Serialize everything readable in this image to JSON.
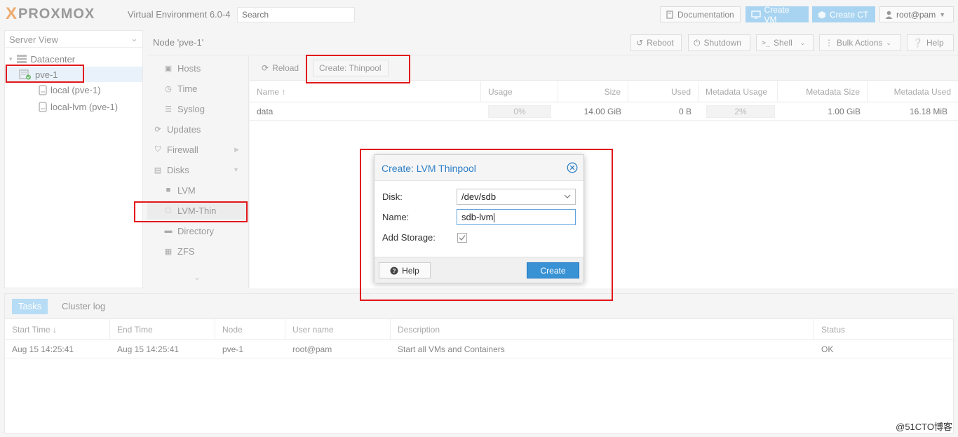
{
  "header": {
    "logo_x": "X",
    "logo_text": "PROXMOX",
    "version": "Virtual Environment 6.0-4",
    "search_placeholder": "Search",
    "documentation": "Documentation",
    "create_vm": "Create VM",
    "create_ct": "Create CT",
    "user": "root@pam"
  },
  "sidebar": {
    "view": "Server View",
    "items": [
      {
        "label": "Datacenter",
        "icon": "server-icon"
      },
      {
        "label": "pve-1",
        "icon": "node-icon",
        "selected": true
      },
      {
        "label": "local (pve-1)",
        "icon": "storage-icon"
      },
      {
        "label": "local-lvm (pve-1)",
        "icon": "storage-icon"
      }
    ]
  },
  "nodebar": {
    "title": "Node 'pve-1'",
    "reboot": "Reboot",
    "shutdown": "Shutdown",
    "shell": "Shell",
    "bulk_actions": "Bulk Actions",
    "help": "Help"
  },
  "menu": {
    "items": [
      {
        "label": "Hosts",
        "icon": "hosts-icon"
      },
      {
        "label": "Time",
        "icon": "clock-icon"
      },
      {
        "label": "Syslog",
        "icon": "list-icon"
      },
      {
        "label": "Updates",
        "icon": "refresh-icon"
      },
      {
        "label": "Firewall",
        "icon": "shield-icon"
      },
      {
        "label": "Disks",
        "icon": "disk-icon"
      },
      {
        "label": "LVM",
        "icon": "square-icon"
      },
      {
        "label": "LVM-Thin",
        "icon": "square-outline-icon"
      },
      {
        "label": "Directory",
        "icon": "folder-icon"
      },
      {
        "label": "ZFS",
        "icon": "grid-icon"
      }
    ]
  },
  "content": {
    "reload": "Reload",
    "create_thinpool": "Create: Thinpool",
    "columns": [
      "Name",
      "Usage",
      "Size",
      "Used",
      "Metadata Usage",
      "Metadata Size",
      "Metadata Used"
    ],
    "rows": [
      {
        "name": "data",
        "usage": "0%",
        "size": "14.00 GiB",
        "used": "0 B",
        "metadata_usage": "2%",
        "metadata_size": "1.00 GiB",
        "metadata_used": "16.18 MiB"
      }
    ]
  },
  "dialog": {
    "title": "Create: LVM Thinpool",
    "disk_label": "Disk:",
    "disk_value": "/dev/sdb",
    "name_label": "Name:",
    "name_value": "sdb-lvm",
    "add_storage_label": "Add Storage:",
    "add_storage_checked": true,
    "help": "Help",
    "create": "Create"
  },
  "tasks": {
    "tab_tasks": "Tasks",
    "tab_cluster_log": "Cluster log",
    "columns": [
      "Start Time",
      "End Time",
      "Node",
      "User name",
      "Description",
      "Status"
    ],
    "rows": [
      {
        "start": "Aug 15 14:25:41",
        "end": "Aug 15 14:25:41",
        "node": "pve-1",
        "user": "root@pam",
        "description": "Start all VMs and Containers",
        "status": "OK"
      }
    ]
  },
  "watermark": "@51CTO博客",
  "colors": {
    "accent": "#3892d4",
    "highlight": "#e3171b",
    "logo_orange": "#e57000"
  }
}
